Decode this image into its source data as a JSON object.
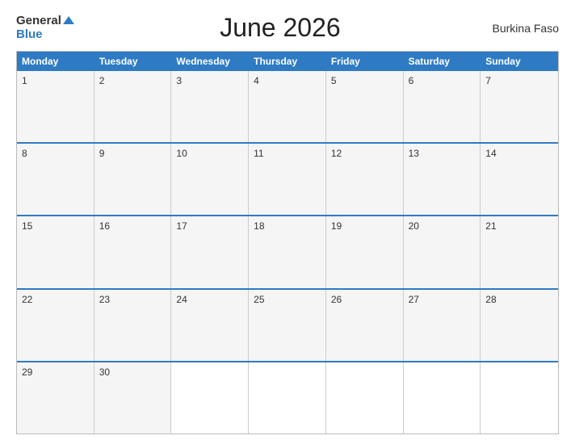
{
  "header": {
    "logo_general": "General",
    "logo_blue": "Blue",
    "title": "June 2026",
    "country": "Burkina Faso"
  },
  "days_of_week": [
    "Monday",
    "Tuesday",
    "Wednesday",
    "Thursday",
    "Friday",
    "Saturday",
    "Sunday"
  ],
  "weeks": [
    [
      {
        "num": "1",
        "empty": false
      },
      {
        "num": "2",
        "empty": false
      },
      {
        "num": "3",
        "empty": false
      },
      {
        "num": "4",
        "empty": false
      },
      {
        "num": "5",
        "empty": false
      },
      {
        "num": "6",
        "empty": false
      },
      {
        "num": "7",
        "empty": false
      }
    ],
    [
      {
        "num": "8",
        "empty": false
      },
      {
        "num": "9",
        "empty": false
      },
      {
        "num": "10",
        "empty": false
      },
      {
        "num": "11",
        "empty": false
      },
      {
        "num": "12",
        "empty": false
      },
      {
        "num": "13",
        "empty": false
      },
      {
        "num": "14",
        "empty": false
      }
    ],
    [
      {
        "num": "15",
        "empty": false
      },
      {
        "num": "16",
        "empty": false
      },
      {
        "num": "17",
        "empty": false
      },
      {
        "num": "18",
        "empty": false
      },
      {
        "num": "19",
        "empty": false
      },
      {
        "num": "20",
        "empty": false
      },
      {
        "num": "21",
        "empty": false
      }
    ],
    [
      {
        "num": "22",
        "empty": false
      },
      {
        "num": "23",
        "empty": false
      },
      {
        "num": "24",
        "empty": false
      },
      {
        "num": "25",
        "empty": false
      },
      {
        "num": "26",
        "empty": false
      },
      {
        "num": "27",
        "empty": false
      },
      {
        "num": "28",
        "empty": false
      }
    ],
    [
      {
        "num": "29",
        "empty": false
      },
      {
        "num": "30",
        "empty": false
      },
      {
        "num": "",
        "empty": true
      },
      {
        "num": "",
        "empty": true
      },
      {
        "num": "",
        "empty": true
      },
      {
        "num": "",
        "empty": true
      },
      {
        "num": "",
        "empty": true
      }
    ]
  ]
}
